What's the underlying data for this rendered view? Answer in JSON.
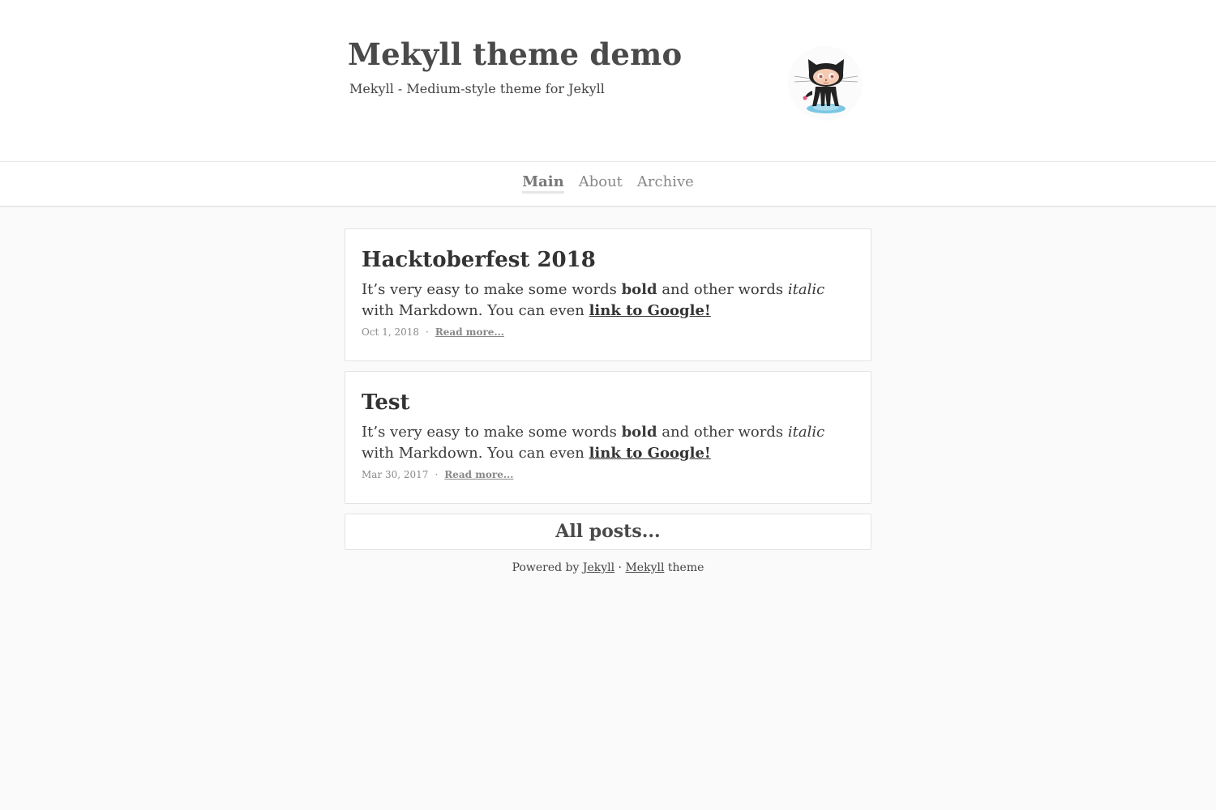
{
  "header": {
    "title": "Mekyll theme demo",
    "subtitle": "Mekyll - Medium-style theme for Jekyll",
    "avatar_icon": "octocat-icon"
  },
  "nav": {
    "items": [
      {
        "label": "Main",
        "active": true
      },
      {
        "label": "About",
        "active": false
      },
      {
        "label": "Archive",
        "active": false
      }
    ]
  },
  "posts": [
    {
      "title": "Hacktoberfest 2018",
      "excerpt": {
        "text1": "It’s very easy to make some words ",
        "bold": "bold",
        "text2": " and other words ",
        "italic": "italic",
        "text3": " with Markdown. You can even ",
        "link": "link to Google!"
      },
      "date": "Oct 1, 2018",
      "separator": "·",
      "read_more": "Read more..."
    },
    {
      "title": "Test",
      "excerpt": {
        "text1": "It’s very easy to make some words ",
        "bold": "bold",
        "text2": " and other words ",
        "italic": "italic",
        "text3": " with Markdown. You can even ",
        "link": "link to Google!"
      },
      "date": "Mar 30, 2017",
      "separator": "·",
      "read_more": "Read more..."
    }
  ],
  "all_posts_label": "All posts...",
  "footer": {
    "prefix": "Powered by ",
    "jekyll_link": "Jekyll",
    "separator": " · ",
    "mekyll_link": "Mekyll",
    "suffix": " theme"
  },
  "colors": {
    "background": "#fafafa",
    "card": "#ffffff",
    "border": "#e3e3e3",
    "title": "#4a4a4a",
    "text": "#333333",
    "muted": "#888888"
  }
}
